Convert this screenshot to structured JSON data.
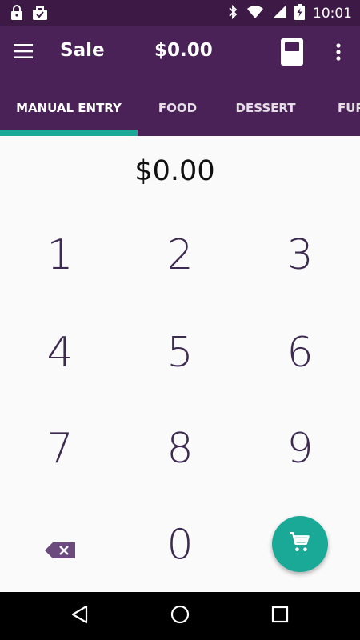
{
  "status_bar": {
    "time": "10:01",
    "icons": [
      "lock-icon",
      "shopping-bag-icon",
      "bluetooth-icon",
      "wifi-icon",
      "signal-icon",
      "battery-icon"
    ]
  },
  "app_bar": {
    "title": "Sale",
    "amount": "$0.00",
    "icons": [
      "hamburger-menu-icon",
      "card-reader-icon",
      "more-vert-icon"
    ]
  },
  "tabs": [
    {
      "label": "MANUAL ENTRY",
      "active": true
    },
    {
      "label": "FOOD",
      "active": false
    },
    {
      "label": "DESSERT",
      "active": false
    },
    {
      "label": "FUR",
      "active": false
    }
  ],
  "entry": {
    "amount": "$0.00"
  },
  "keypad": {
    "keys": [
      "1",
      "2",
      "3",
      "4",
      "5",
      "6",
      "7",
      "8",
      "9",
      "0"
    ],
    "backspace_icon": "backspace-icon",
    "cart_icon": "cart-icon"
  },
  "navigation": {
    "icons": [
      "back-icon",
      "home-icon",
      "recents-icon"
    ]
  },
  "colors": {
    "status_bar": "#3c1a45",
    "app_bar": "#4a2257",
    "accent": "#1aa897",
    "key_text": "#3d2a50"
  }
}
